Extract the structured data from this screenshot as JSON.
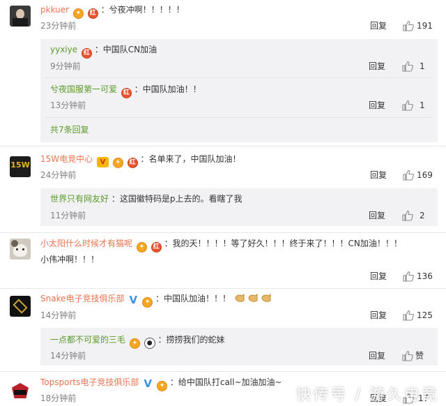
{
  "comments": [
    {
      "user": "pkkuer",
      "text": "：兮夜冲啊！！！！！",
      "time": "23分钟前",
      "reply": "回复",
      "likes": "191",
      "replies": [
        {
          "user": "yyxiye",
          "text": "：中国队CN加油",
          "time": "9分钟前",
          "reply": "回复",
          "likes": "1"
        },
        {
          "user": "兮夜国服第一可爱",
          "text": "：中国队加油！！",
          "time": "13分钟前",
          "reply": "回复",
          "likes": "1"
        }
      ],
      "more": "共7条回复"
    },
    {
      "user": "15W电竞中心",
      "text": "：名单来了，中国队加油！",
      "time": "24分钟前",
      "reply": "回复",
      "likes": "169",
      "replies": [
        {
          "user": "世界只有网友好",
          "text": "：这国徽特码是p上去的。看瞎了我",
          "time": "11分钟前",
          "reply": "回复",
          "likes": "2"
        }
      ]
    },
    {
      "user": "小太阳什么时候才有猫呢",
      "text": "：我的天！！！！等了好久！！！终于来了！！！CN加油！！！",
      "text2": "小伟冲啊！！！",
      "time": "",
      "reply": "回复",
      "likes": "136"
    },
    {
      "user": "Snake电子竞技俱乐部",
      "text": "：中国队加油！！！",
      "time": "14分钟前",
      "reply": "回复",
      "likes": "125",
      "replies": [
        {
          "user": "一点都不可爱的三毛",
          "text": "：捞捞我们的蛇妹",
          "time": "14分钟前",
          "reply": "回复",
          "likes": "赞"
        }
      ]
    },
    {
      "user": "Topsports电子竞技俱乐部",
      "text": "：给中国队打call~加油加油~",
      "time": "18分钟前",
      "reply": "回复",
      "likes": "17"
    }
  ],
  "avatars": {
    "c2": "15W"
  },
  "watermark": "快传号 / 游久电竞",
  "colors": {
    "username": "#eb7350",
    "reply_username": "#5a9a2a",
    "sub_bg": "#f2f2f5"
  }
}
